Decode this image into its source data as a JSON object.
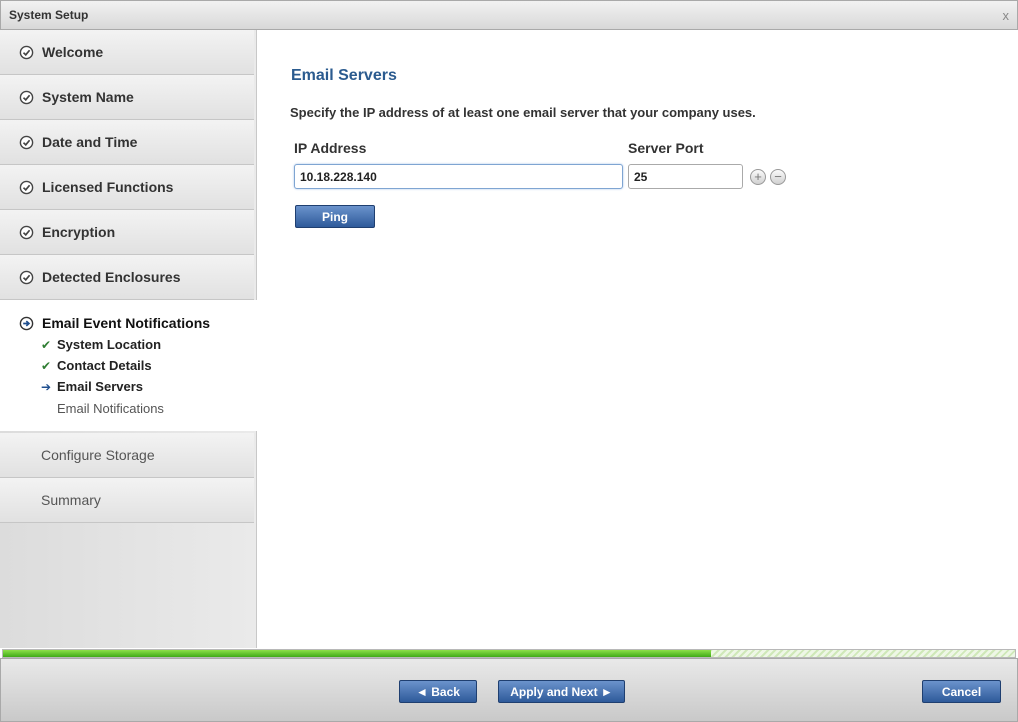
{
  "window": {
    "title": "System Setup",
    "close_glyph": "x"
  },
  "sidebar": {
    "completed": [
      {
        "label": "Welcome"
      },
      {
        "label": "System Name"
      },
      {
        "label": "Date and Time"
      },
      {
        "label": "Licensed Functions"
      },
      {
        "label": "Encryption"
      },
      {
        "label": "Detected Enclosures"
      }
    ],
    "active": {
      "label": "Email Event Notifications",
      "sub_items": [
        {
          "label": "System Location",
          "state": "done"
        },
        {
          "label": "Contact Details",
          "state": "done"
        },
        {
          "label": "Email Servers",
          "state": "current"
        },
        {
          "label": "Email Notifications",
          "state": "todo"
        }
      ]
    },
    "pending": [
      {
        "label": "Configure Storage"
      },
      {
        "label": "Summary"
      }
    ]
  },
  "main": {
    "title": "Email Servers",
    "instructions": "Specify the IP address of at least one email server that your company uses.",
    "ip_label": "IP Address",
    "port_label": "Server Port",
    "ip_value": "10.18.228.140",
    "port_value": "25",
    "add_glyph": "+",
    "remove_glyph": "−",
    "ping_label": "Ping"
  },
  "progress": {
    "fraction": 0.7
  },
  "footer": {
    "back_label": "◄ Back",
    "next_label": "Apply and Next ►",
    "cancel_label": "Cancel"
  },
  "colors": {
    "accent_blue": "#2b5b8f",
    "progress_green": "#3faa17",
    "check_green": "#2e7d32"
  }
}
